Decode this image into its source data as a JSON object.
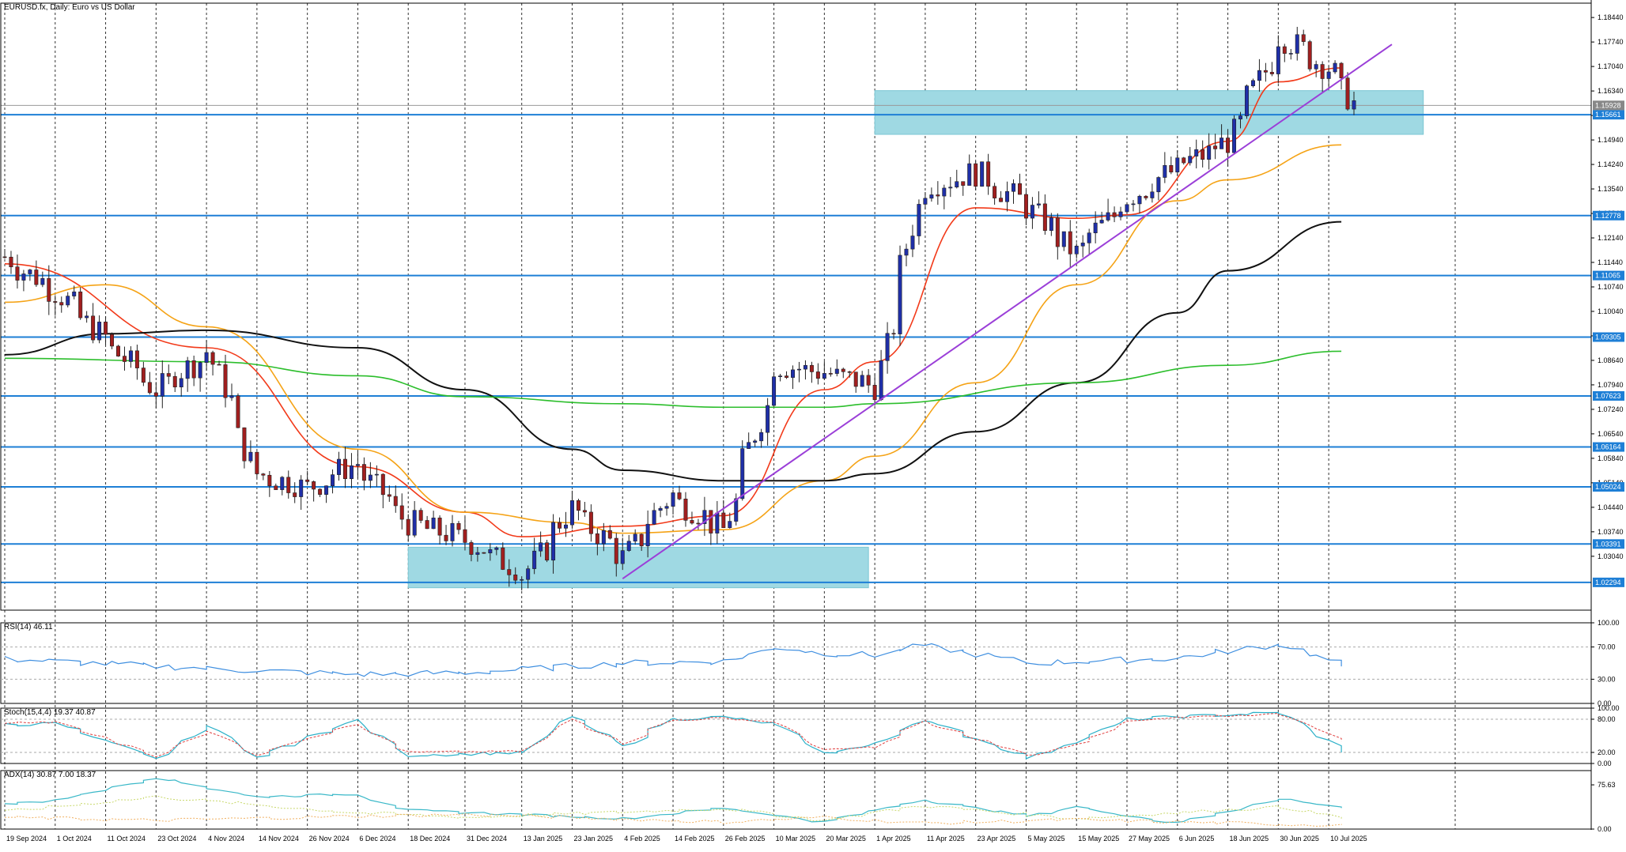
{
  "header": {
    "symbol_title": "EURUSD.fx, Daily:  Euro vs US Dollar"
  },
  "indicators": {
    "rsi_label": "RSI(14) 46.11",
    "stoch_label": "Stoch(15,4,4) 19.37 40.87",
    "adx_label": "ADX(14) 30.87 7.00 18.37"
  },
  "colors": {
    "candle_up": "#1f2fa8",
    "candle_down": "#a11f1f",
    "level_line": "#1e7fd6",
    "zone_fill": "#9fd9e3",
    "ma_red": "#f23a1a",
    "ma_orange": "#f5a316",
    "ma_black": "#111111",
    "ma_green": "#2cbe2c",
    "trendline": "#9b3fd8",
    "rsi_line": "#3f8fe0",
    "stoch_main": "#2ab0c8",
    "stoch_signal": "#e04040",
    "adx_main": "#3ab8c8",
    "adx_plus": "#c8d86a",
    "adx_minus": "#f0b060"
  },
  "chart_data": [
    {
      "type": "candlestick",
      "pane": "price",
      "ylim": [
        1.015,
        1.1885
      ],
      "price_ticks": [
        "1.18440",
        "1.17740",
        "1.17040",
        "1.16340",
        "1.15640",
        "1.14940",
        "1.14240",
        "1.13540",
        "1.12840",
        "1.12140",
        "1.11440",
        "1.10740",
        "1.10040",
        "1.09340",
        "1.08640",
        "1.07940",
        "1.07240",
        "1.06540",
        "1.05840",
        "1.05140",
        "1.04440",
        "1.03740",
        "1.03040"
      ],
      "level_lines": [
        "1.15661",
        "1.12778",
        "1.11065",
        "1.09305",
        "1.07623",
        "1.06164",
        "1.05024",
        "1.03391",
        "1.02294"
      ],
      "current_price_label": "1.15928",
      "date_labels": [
        "19 Sep 2024",
        "1 Oct 2024",
        "11 Oct 2024",
        "23 Oct 2024",
        "4 Nov 2024",
        "14 Nov 2024",
        "26 Nov 2024",
        "6 Dec 2024",
        "18 Dec 2024",
        "31 Dec 2024",
        "13 Jan 2025",
        "23 Jan 2025",
        "4 Feb 2025",
        "14 Feb 2025",
        "26 Feb 2025",
        "10 Mar 2025",
        "20 Mar 2025",
        "1 Apr 2025",
        "11 Apr 2025",
        "23 Apr 2025",
        "5 May 2025",
        "15 May 2025",
        "27 May 2025",
        "6 Jun 2025",
        "18 Jun 2025",
        "30 Jun 2025",
        "10 Jul 2025"
      ],
      "zones": [
        {
          "from_date": "18 Dec 2024",
          "to_date": "31 Mar 2025",
          "low": 1.0214,
          "high": 1.033
        },
        {
          "from_date": "1 Apr 2025",
          "to_date": "31 Jul 2025",
          "low": 1.151,
          "high": 1.1635
        }
      ],
      "trendline": {
        "from": [
          "4 Feb 2025",
          1.024
        ],
        "to": [
          "17 Jul 2025",
          1.174
        ]
      },
      "moving_averages": [
        {
          "color": "ma_red",
          "x": [
            "19 Sep 2024",
            "4 Nov 2024",
            "6 Dec 2024",
            "31 Dec 2024",
            "13 Jan 2025",
            "4 Feb 2025",
            "26 Feb 2025",
            "20 Mar 2025",
            "1 Apr 2025",
            "23 Apr 2025",
            "15 May 2025",
            "27 May 2025",
            "18 Jun 2025",
            "30 Jun 2025",
            "14 Jul 2025"
          ],
          "y": [
            1.114,
            1.09,
            1.056,
            1.043,
            1.036,
            1.039,
            1.042,
            1.078,
            1.086,
            1.13,
            1.127,
            1.128,
            1.149,
            1.166,
            1.17
          ]
        },
        {
          "color": "ma_orange",
          "x": [
            "19 Sep 2024",
            "11 Oct 2024",
            "4 Nov 2024",
            "6 Dec 2024",
            "31 Dec 2024",
            "23 Jan 2025",
            "4 Feb 2025",
            "26 Feb 2025",
            "20 Mar 2025",
            "1 Apr 2025",
            "23 Apr 2025",
            "15 May 2025",
            "6 Jun 2025",
            "18 Jun 2025",
            "14 Jul 2025"
          ],
          "y": [
            1.103,
            1.108,
            1.096,
            1.061,
            1.043,
            1.04,
            1.037,
            1.038,
            1.052,
            1.059,
            1.08,
            1.108,
            1.132,
            1.138,
            1.148
          ]
        },
        {
          "color": "ma_black",
          "x": [
            "19 Sep 2024",
            "11 Oct 2024",
            "4 Nov 2024",
            "6 Dec 2024",
            "31 Dec 2024",
            "23 Jan 2025",
            "4 Feb 2025",
            "26 Feb 2025",
            "20 Mar 2025",
            "1 Apr 2025",
            "23 Apr 2025",
            "15 May 2025",
            "6 Jun 2025",
            "18 Jun 2025",
            "14 Jul 2025"
          ],
          "y": [
            1.088,
            1.094,
            1.095,
            1.09,
            1.078,
            1.061,
            1.055,
            1.052,
            1.052,
            1.054,
            1.066,
            1.08,
            1.1,
            1.112,
            1.126
          ]
        },
        {
          "color": "ma_green",
          "x": [
            "19 Sep 2024",
            "4 Nov 2024",
            "6 Dec 2024",
            "31 Dec 2024",
            "4 Feb 2025",
            "26 Feb 2025",
            "20 Mar 2025",
            "1 Apr 2025",
            "15 May 2025",
            "18 Jun 2025",
            "14 Jul 2025"
          ],
          "y": [
            1.087,
            1.086,
            1.082,
            1.076,
            1.074,
            1.073,
            1.073,
            1.074,
            1.08,
            1.085,
            1.089
          ]
        }
      ]
    },
    {
      "type": "line",
      "pane": "rsi",
      "title": "RSI(14) 46.11",
      "ylim": [
        0,
        100
      ],
      "ticks": [
        "100.00",
        "70.00",
        "30.00",
        "0.00"
      ],
      "levels": [
        70,
        30
      ],
      "x": [
        "19 Sep 2024",
        "4 Nov 2024",
        "6 Dec 2024",
        "31 Dec 2024",
        "4 Feb 2025",
        "26 Feb 2025",
        "10 Mar 2025",
        "20 Mar 2025",
        "1 Apr 2025",
        "11 Apr 2025",
        "5 May 2025",
        "6 Jun 2025",
        "30 Jun 2025",
        "14 Jul 2025"
      ],
      "y": [
        55,
        43,
        36,
        38,
        50,
        52,
        70,
        62,
        60,
        72,
        50,
        56,
        74,
        46
      ]
    },
    {
      "type": "line",
      "pane": "stochastic",
      "title": "Stoch(15,4,4) 19.37 40.87",
      "ylim": [
        0,
        100
      ],
      "ticks": [
        "100.00",
        "80.00",
        "20.00",
        "0.00"
      ],
      "levels": [
        80,
        20
      ],
      "series": [
        {
          "x": [
            "19 Sep 2024",
            "1 Oct 2024",
            "23 Oct 2024",
            "4 Nov 2024",
            "14 Nov 2024",
            "6 Dec 2024",
            "18 Dec 2024",
            "13 Jan 2025",
            "23 Jan 2025",
            "4 Feb 2025",
            "14 Feb 2025",
            "26 Feb 2025",
            "10 Mar 2025",
            "20 Mar 2025",
            "1 Apr 2025",
            "11 Apr 2025",
            "5 May 2025",
            "15 May 2025",
            "27 May 2025",
            "6 Jun 2025",
            "30 Jun 2025",
            "14 Jul 2025"
          ],
          "y": [
            70,
            72,
            10,
            68,
            10,
            78,
            15,
            20,
            86,
            30,
            80,
            84,
            70,
            18,
            35,
            80,
            10,
            40,
            80,
            84,
            92,
            20
          ]
        },
        {
          "x": [
            "19 Sep 2024",
            "1 Oct 2024",
            "23 Oct 2024",
            "4 Nov 2024",
            "14 Nov 2024",
            "6 Dec 2024",
            "18 Dec 2024",
            "13 Jan 2025",
            "23 Jan 2025",
            "4 Feb 2025",
            "14 Feb 2025",
            "26 Feb 2025",
            "10 Mar 2025",
            "20 Mar 2025",
            "1 Apr 2025",
            "11 Apr 2025",
            "5 May 2025",
            "15 May 2025",
            "27 May 2025",
            "6 Jun 2025",
            "30 Jun 2025",
            "14 Jul 2025"
          ],
          "y": [
            74,
            74,
            14,
            60,
            16,
            72,
            20,
            22,
            80,
            36,
            78,
            82,
            74,
            24,
            30,
            76,
            14,
            34,
            76,
            82,
            90,
            40
          ]
        }
      ]
    },
    {
      "type": "line",
      "pane": "adx",
      "title": "ADX(14) 30.87 7.00 18.37",
      "ylim": [
        0,
        100
      ],
      "ticks": [
        "75.63",
        "0.00"
      ],
      "series": [
        {
          "x": [
            "19 Sep 2024",
            "1 Oct 2024",
            "23 Oct 2024",
            "14 Nov 2024",
            "6 Dec 2024",
            "18 Dec 2024",
            "4 Feb 2025",
            "26 Feb 2025",
            "20 Mar 2025",
            "11 Apr 2025",
            "5 May 2025",
            "15 May 2025",
            "6 Jun 2025",
            "30 Jun 2025",
            "14 Jul 2025"
          ],
          "y": [
            42,
            50,
            88,
            55,
            60,
            32,
            18,
            36,
            12,
            50,
            22,
            38,
            10,
            52,
            36
          ]
        },
        {
          "x": [
            "19 Sep 2024",
            "23 Oct 2024",
            "6 Dec 2024",
            "31 Dec 2024",
            "26 Feb 2025",
            "20 Mar 2025",
            "11 Apr 2025",
            "15 May 2025",
            "30 Jun 2025",
            "14 Jul 2025"
          ],
          "y": [
            30,
            55,
            28,
            20,
            35,
            15,
            40,
            18,
            38,
            18
          ]
        },
        {
          "x": [
            "19 Sep 2024",
            "23 Oct 2024",
            "6 Dec 2024",
            "31 Dec 2024",
            "26 Feb 2025",
            "20 Mar 2025",
            "11 Apr 2025",
            "15 May 2025",
            "30 Jun 2025",
            "14 Jul 2025"
          ],
          "y": [
            20,
            15,
            22,
            25,
            12,
            20,
            10,
            16,
            8,
            7
          ]
        }
      ]
    }
  ]
}
